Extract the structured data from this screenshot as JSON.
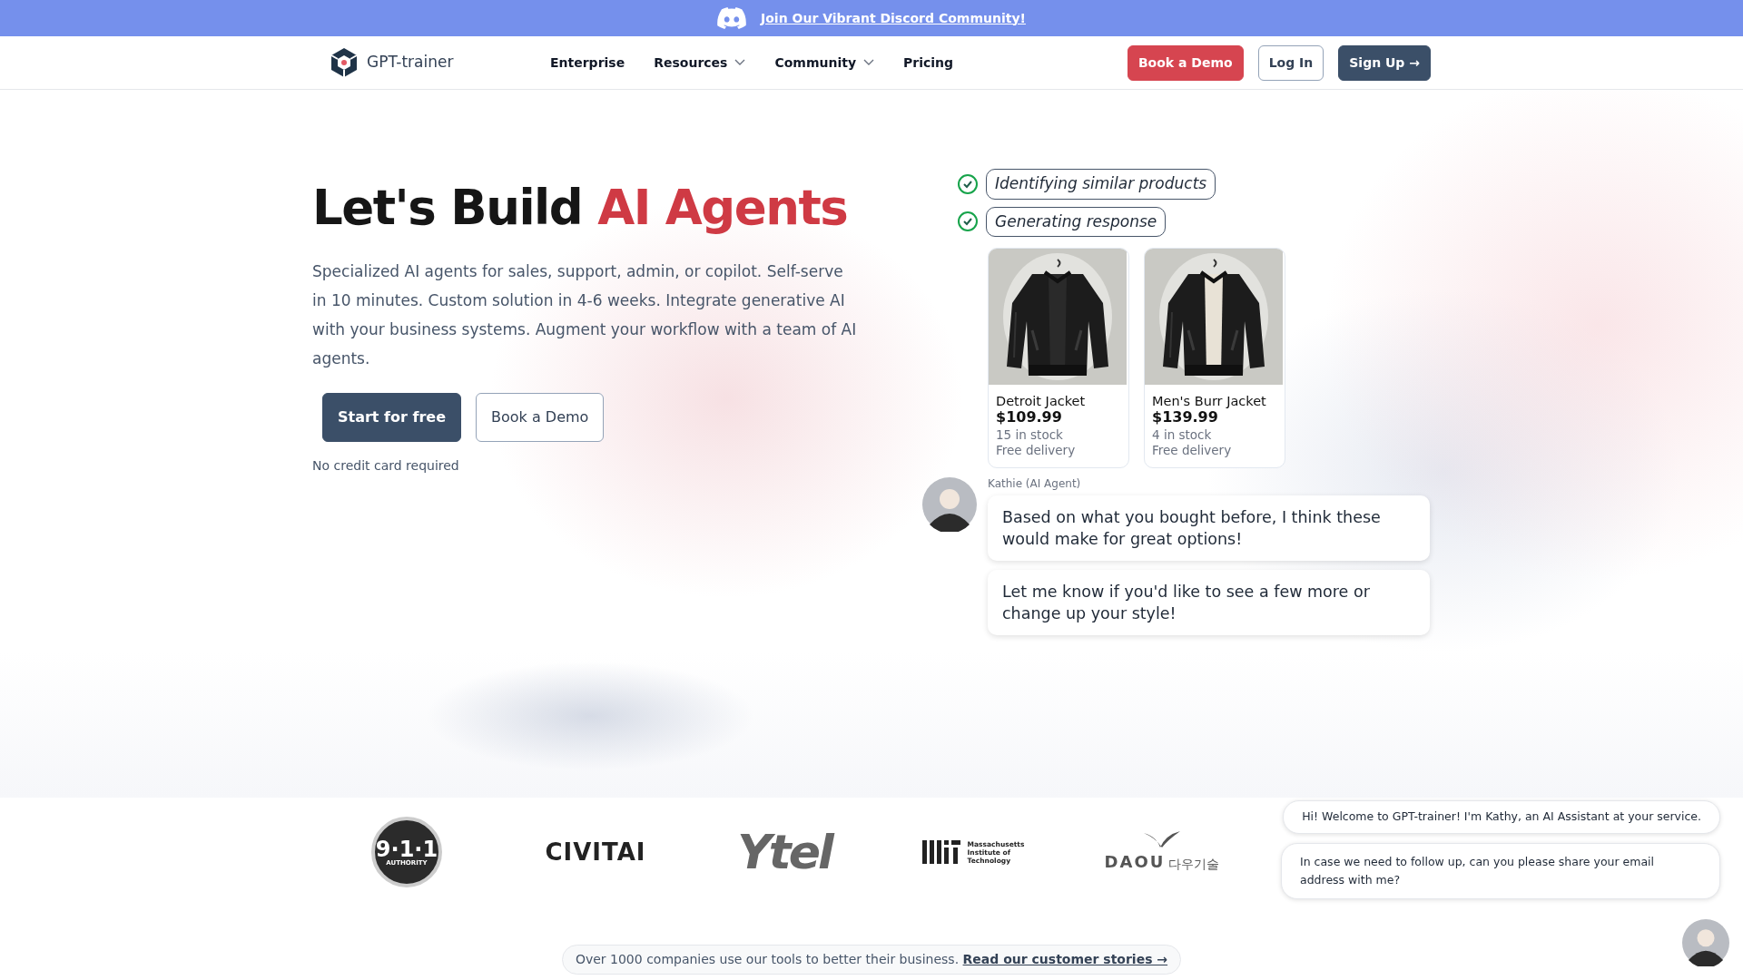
{
  "banner": {
    "text": "Join Our Vibrant Discord Community!"
  },
  "nav": {
    "brand": "GPT-trainer",
    "links": [
      {
        "label": "Enterprise",
        "dropdown": false
      },
      {
        "label": "Resources",
        "dropdown": true
      },
      {
        "label": "Community",
        "dropdown": true
      },
      {
        "label": "Pricing",
        "dropdown": false
      }
    ],
    "buttons": [
      {
        "label": "Book a Demo",
        "kind": "danger"
      },
      {
        "label": "Log In",
        "kind": "outline"
      },
      {
        "label": "Sign Up →",
        "kind": "dark"
      }
    ]
  },
  "hero": {
    "title": "Let's Build",
    "title_accent": "AI Agents",
    "description": "Specialized AI agents for sales, support, admin, or copilot. Self-serve in 10 minutes. Custom solution in 4-6 weeks. Integrate generative AI with your business systems. Augment your workflow with a team of AI agents.",
    "buttons": [
      {
        "label": "Start for free",
        "kind": "dark"
      },
      {
        "label": "Book a Demo",
        "kind": "outline"
      }
    ],
    "note": "No credit card required"
  },
  "demo": {
    "steps": [
      {
        "label": "Identifying similar products",
        "done": true
      },
      {
        "label": "Generating response",
        "done": true
      }
    ],
    "products": [
      {
        "name": "Detroit Jacket",
        "price": "$109.99",
        "stock": "15 in stock",
        "delivery": "Free delivery",
        "kind": "picture"
      },
      {
        "name": "Men's Burr Jacket",
        "price": "$139.99",
        "stock": "4 in stock",
        "delivery": "Free delivery",
        "kind": "picture"
      }
    ],
    "agent_name": "Kathie (AI Agent)",
    "messages": [
      "Based on what you bought before, I think these would make for great options!",
      "Let me know if you'd like to see a few more or change up your style!"
    ]
  },
  "logos": [
    {
      "kind": "badge",
      "texts": [
        "9·1·1",
        "AUTHORITY"
      ]
    },
    {
      "kind": "wordmark",
      "texts": [
        "CIVITAI"
      ]
    },
    {
      "kind": "swoosh",
      "texts": [
        "Ytel"
      ]
    },
    {
      "kind": "mit",
      "texts": [
        "Massachusetts",
        "Institute of",
        "Technology"
      ]
    },
    {
      "kind": "bird",
      "texts": [
        "DAOU",
        "다우기술"
      ]
    }
  ],
  "footer_note": {
    "text": "Over 1000 companies use our tools to better their business.",
    "link": "Read our customer stories →"
  },
  "chat_widget": {
    "messages": [
      "Hi! Welcome to GPT-trainer! I'm Kathy, an AI Assistant at your service.",
      "In case we need to follow up, can you please share your email address with me?"
    ]
  }
}
